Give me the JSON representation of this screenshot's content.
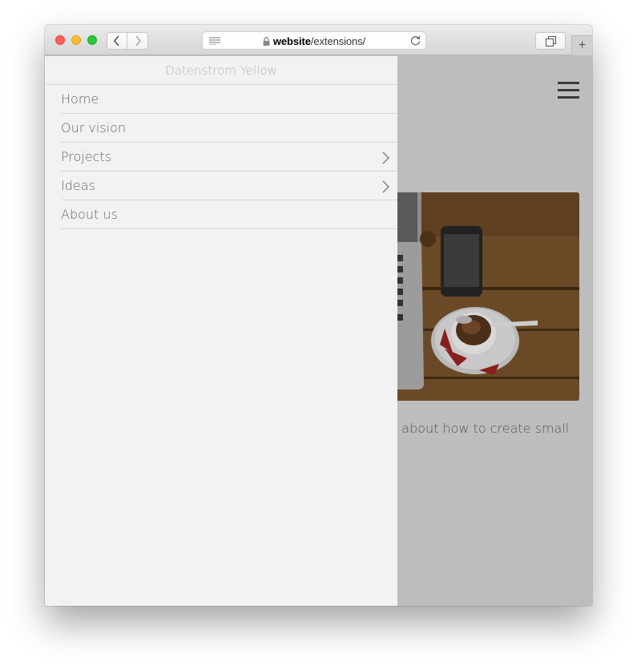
{
  "browser": {
    "url_host": "website",
    "url_path": "/extensions/",
    "new_tab_symbol": "+",
    "icons": {
      "back": "chevron-left-icon",
      "forward": "chevron-right-icon",
      "reader": "reader-icon",
      "lock": "lock-icon",
      "reload": "reload-icon",
      "tabs": "tabs-overview-icon"
    }
  },
  "menu": {
    "site_title": "Datenstrom Yellow",
    "items": [
      {
        "label": "Home",
        "has_children": false
      },
      {
        "label": "Our vision",
        "has_children": false
      },
      {
        "label": "Projects",
        "has_children": true
      },
      {
        "label": "Ideas",
        "has_children": true
      },
      {
        "label": "About us",
        "has_children": false
      }
    ]
  },
  "page": {
    "visible_text": "n about how to create small",
    "menu_icon": "hamburger-icon"
  },
  "colors": {
    "menu_background": "#f2f2f2",
    "overlay": "#bdbdbd",
    "text": "#666666"
  }
}
